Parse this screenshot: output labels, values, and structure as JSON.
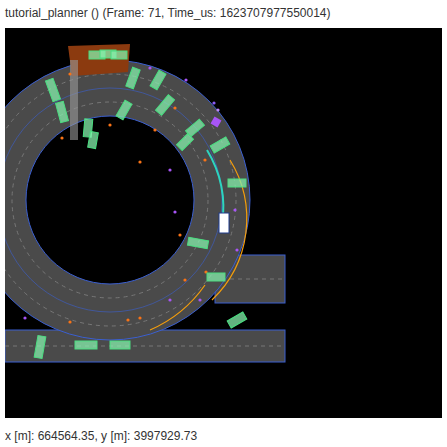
{
  "window": {
    "title": "tutorial_planner () (Frame: 71, Time_us: 1623707977550014)"
  },
  "status_bar": {
    "cursor": "x [m]: 664564.35, y [m]: 3997929.73"
  }
}
